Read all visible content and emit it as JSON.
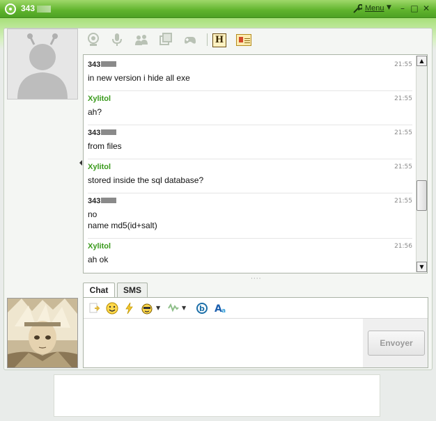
{
  "window": {
    "title": "343",
    "menu_label": "Menu",
    "controls": {
      "minimize": "–",
      "maximize": "□",
      "close": "✕"
    }
  },
  "toolbar": {
    "icons": [
      "webcam-icon",
      "microphone-icon",
      "contacts-icon",
      "windows-icon",
      "gamepad-icon",
      "h-icon",
      "contact-card-icon"
    ],
    "h_label": "H"
  },
  "conversation": {
    "messages": [
      {
        "sender": "343",
        "self": true,
        "time": "21:55",
        "lines": [
          "in new version i hide all exe"
        ]
      },
      {
        "sender": "Xylitol",
        "self": false,
        "time": "21:55",
        "lines": [
          "ah?"
        ]
      },
      {
        "sender": "343",
        "self": true,
        "time": "21:55",
        "lines": [
          "from files"
        ]
      },
      {
        "sender": "Xylitol",
        "self": false,
        "time": "21:55",
        "lines": [
          "stored inside the sql database?"
        ]
      },
      {
        "sender": "343",
        "self": true,
        "time": "21:55",
        "lines": [
          "no",
          "name md5(id+salt)"
        ]
      },
      {
        "sender": "Xylitol",
        "self": false,
        "time": "21:56",
        "lines": [
          "ah ok"
        ]
      }
    ]
  },
  "tabs": [
    {
      "label": "Chat",
      "active": true
    },
    {
      "label": "SMS",
      "active": false
    }
  ],
  "input": {
    "value": "",
    "send_label": "Envoyer",
    "toolbar_icons": [
      "file-transfer-icon",
      "smiley-icon",
      "nudge-icon",
      "wink-icon",
      "voice-clip-icon",
      "bing-icon",
      "font-icon"
    ]
  },
  "colors": {
    "accent": "#5fb32c",
    "other_sender": "#3a9a1c"
  }
}
